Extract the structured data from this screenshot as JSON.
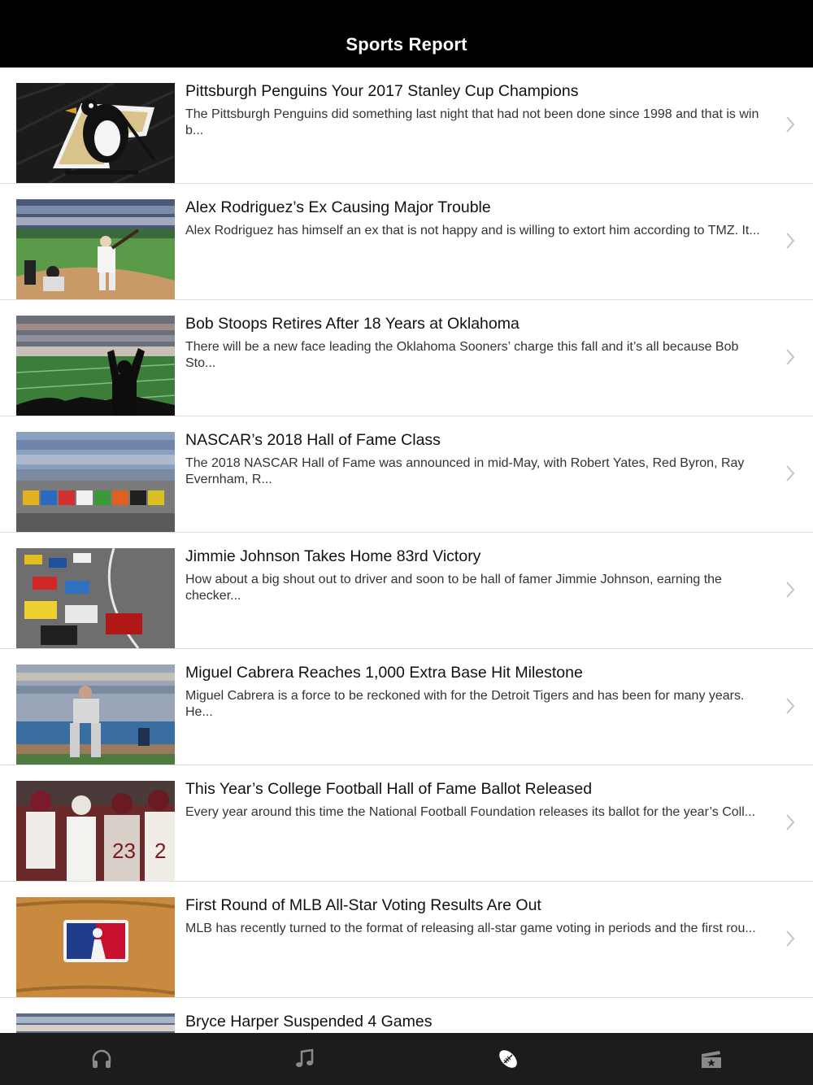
{
  "navbar": {
    "title": "Sports Report"
  },
  "articles": [
    {
      "title": "Pittsburgh Penguins Your 2017 Stanley Cup Champions",
      "summary": "The Pittsburgh Penguins did something last night that had not been done since 1998 and that is win b...",
      "thumbnail": "penguins-logo-jersey"
    },
    {
      "title": "Alex Rodriguez’s Ex Causing Major Trouble",
      "summary": "Alex Rodriguez has himself an ex that is not happy and is willing to extort him according to TMZ. It...",
      "thumbnail": "baseball-batter-at-plate"
    },
    {
      "title": "Bob Stoops Retires After 18 Years at Oklahoma",
      "summary": "There will be a new face leading the Oklahoma Sooners’ charge this fall and it’s all because Bob Sto...",
      "thumbnail": "football-stadium-fan-silhouette"
    },
    {
      "title": "NASCAR’s 2018 Hall of Fame Class",
      "summary": "The 2018 NASCAR Hall of Fame was announced in mid-May, with Robert Yates, Red Byron, Ray Evernham, R...",
      "thumbnail": "nascar-cars-lined-up"
    },
    {
      "title": "Jimmie Johnson Takes Home 83rd Victory",
      "summary": "How about a big shout out to driver and soon to be hall of famer Jimmie Johnson, earning the checker...",
      "thumbnail": "nascar-race-on-track"
    },
    {
      "title": "Miguel Cabrera Reaches 1,000 Extra Base Hit Milestone",
      "summary": "Miguel Cabrera is a force to be reckoned with for the Detroit Tigers and has been for many years. He...",
      "thumbnail": "baseball-infielder"
    },
    {
      "title": "This Year’s College Football Hall of Fame Ballot Released",
      "summary": "Every year around this time the National Football Foundation releases its ballot for the year’s Coll...",
      "thumbnail": "college-football-players"
    },
    {
      "title": "First Round of MLB All-Star Voting Results Are Out",
      "summary": "MLB has recently turned to the format of releasing all-star game voting in periods and the first rou...",
      "thumbnail": "mlb-logo-on-glove"
    },
    {
      "title": "Bryce Harper Suspended 4 Games",
      "summary": "",
      "thumbnail": "baseball-crowd"
    }
  ],
  "tabbar": {
    "tabs": [
      {
        "icon": "headphones-icon",
        "selected": false
      },
      {
        "icon": "music-note-icon",
        "selected": false
      },
      {
        "icon": "football-icon",
        "selected": true
      },
      {
        "icon": "ticket-icon",
        "selected": false
      }
    ],
    "colors": {
      "selected": "#ffffff",
      "unselected": "#8a8a8a"
    }
  }
}
